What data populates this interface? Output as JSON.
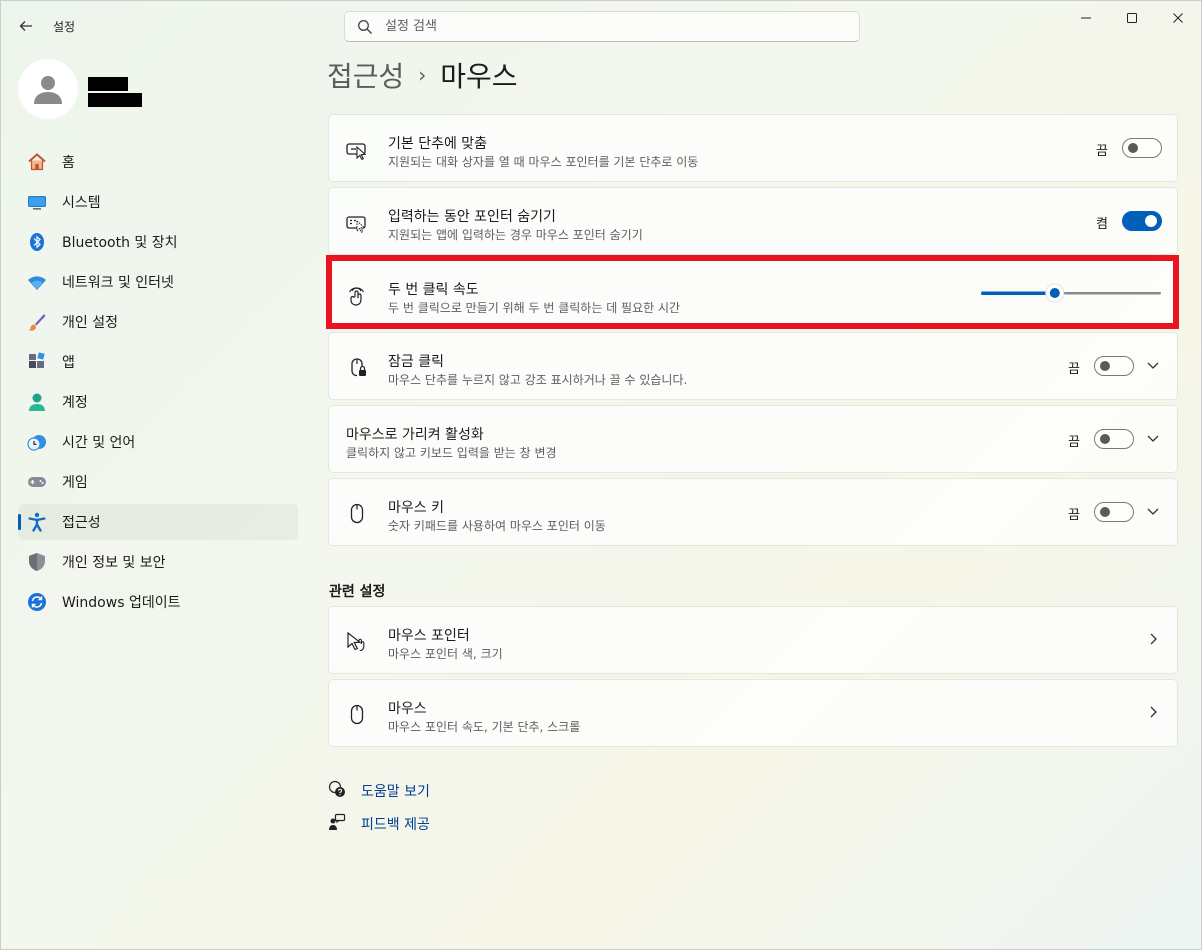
{
  "app": {
    "title": "설정",
    "back_icon": "back-arrow-icon"
  },
  "search": {
    "placeholder": "설정 검색"
  },
  "window_controls": [
    "minimize",
    "maximize",
    "close"
  ],
  "nav": {
    "items": [
      {
        "label": "홈",
        "icon": "home-icon"
      },
      {
        "label": "시스템",
        "icon": "system-icon"
      },
      {
        "label": "Bluetooth 및 장치",
        "icon": "bluetooth-icon"
      },
      {
        "label": "네트워크 및 인터넷",
        "icon": "wifi-icon"
      },
      {
        "label": "개인 설정",
        "icon": "brush-icon"
      },
      {
        "label": "앱",
        "icon": "apps-icon"
      },
      {
        "label": "계정",
        "icon": "account-icon"
      },
      {
        "label": "시간 및 언어",
        "icon": "clock-globe-icon"
      },
      {
        "label": "게임",
        "icon": "gamepad-icon"
      },
      {
        "label": "접근성",
        "icon": "accessibility-icon",
        "selected": true
      },
      {
        "label": "개인 정보 및 보안",
        "icon": "shield-icon"
      },
      {
        "label": "Windows 업데이트",
        "icon": "update-icon"
      }
    ]
  },
  "breadcrumb": {
    "parent": "접근성",
    "separator": "›",
    "current": "마우스"
  },
  "settings": [
    {
      "title": "기본 단추에 맞춤",
      "subtitle": "지원되는 대화 상자를 열 때 마우스 포인터를 기본 단추로 이동",
      "state": "끔",
      "on": false
    },
    {
      "title": "입력하는 동안 포인터 숨기기",
      "subtitle": "지원되는 앱에 입력하는 경우 마우스 포인터 숨기기",
      "state": "켬",
      "on": true
    },
    {
      "title": "두 번 클릭 속도",
      "subtitle": "두 번 클릭으로 만들기 위해 두 번 클릭하는 데 필요한 시간",
      "slider_value": 0.4
    },
    {
      "title": "잠금 클릭",
      "subtitle": "마우스 단추를 누르지 않고 강조 표시하거나 끌 수 있습니다.",
      "state": "끔",
      "on": false
    },
    {
      "title": "마우스로 가리켜 활성화",
      "subtitle": "클릭하지 않고 키보드 입력을 받는 창 변경",
      "state": "끔",
      "on": false
    },
    {
      "title": "마우스 키",
      "subtitle": "숫자 키패드를 사용하여 마우스 포인터 이동",
      "state": "끔",
      "on": false
    }
  ],
  "related": {
    "heading": "관련 설정",
    "items": [
      {
        "title": "마우스 포인터",
        "subtitle": "마우스 포인터 색, 크기"
      },
      {
        "title": "마우스",
        "subtitle": "마우스 포인터 속도, 기본 단추, 스크롤"
      }
    ]
  },
  "help": {
    "get_help": "도움말 보기",
    "feedback": "피드백 제공"
  },
  "colors": {
    "accent": "#005fb8",
    "highlight_box": "#e8141f"
  }
}
